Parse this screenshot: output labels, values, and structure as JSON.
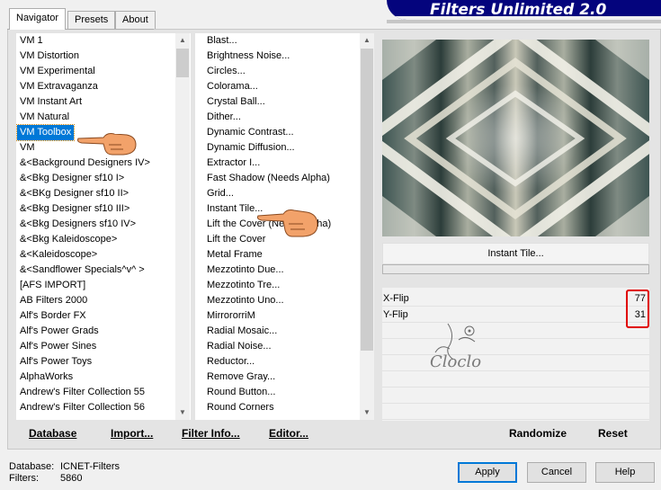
{
  "tabs": [
    {
      "label": "Navigator",
      "active": true
    },
    {
      "label": "Presets",
      "active": false
    },
    {
      "label": "About",
      "active": false
    }
  ],
  "banner_title": "Filters Unlimited 2.0",
  "categories": {
    "items": [
      "VM 1",
      "VM Distortion",
      "VM Experimental",
      "VM Extravaganza",
      "VM Instant Art",
      "VM Natural",
      "VM Toolbox",
      "VM",
      "&<Background Designers IV>",
      "&<Bkg Designer sf10 I>",
      "&<BKg Designer sf10 II>",
      "&<Bkg Designer sf10 III>",
      "&<Bkg Designers sf10 IV>",
      "&<Bkg Kaleidoscope>",
      "&<Kaleidoscope>",
      "&<Sandflower Specials^v^ >",
      "[AFS IMPORT]",
      "AB Filters 2000",
      "Alf's Border FX",
      "Alf's Power Grads",
      "Alf's Power Sines",
      "Alf's Power Toys",
      "AlphaWorks",
      "Andrew's Filter Collection 55",
      "Andrew's Filter Collection 56"
    ],
    "selected": "VM Toolbox"
  },
  "filters": {
    "items": [
      "Blast...",
      "Brightness Noise...",
      "Circles...",
      "Colorama...",
      "Crystal Ball...",
      "Dither...",
      "Dynamic Contrast...",
      "Dynamic Diffusion...",
      "Extractor I...",
      "Fast Shadow (Needs Alpha)",
      "Grid...",
      "Instant Tile...",
      "Lift the Cover (Needs Alpha)",
      "Lift the Cover",
      "Metal Frame",
      "Mezzotinto Due...",
      "Mezzotinto Tre...",
      "Mezzotinto Uno...",
      "MirrororriM",
      "Radial Mosaic...",
      "Radial Noise...",
      "Reductor...",
      "Remove Gray...",
      "Round Button...",
      "Round Corners"
    ]
  },
  "list_buttons": {
    "database": "Database",
    "import": "Import...",
    "filter_info": "Filter Info...",
    "editor": "Editor..."
  },
  "effect_name": "Instant Tile...",
  "params": [
    {
      "label": "X-Flip",
      "value": "77"
    },
    {
      "label": "Y-Flip",
      "value": "31"
    }
  ],
  "panel_buttons": {
    "randomize": "Randomize",
    "reset": "Reset"
  },
  "status": {
    "database_label": "Database:",
    "database_value": "ICNET-Filters",
    "filters_label": "Filters:",
    "filters_value": "5860"
  },
  "dialog_buttons": {
    "apply": "Apply",
    "cancel": "Cancel",
    "help": "Help"
  },
  "watermark_text": "Cloclo",
  "colors": {
    "selection": "#0078d7",
    "banner": "#04047d",
    "highlight": "#e00000"
  }
}
